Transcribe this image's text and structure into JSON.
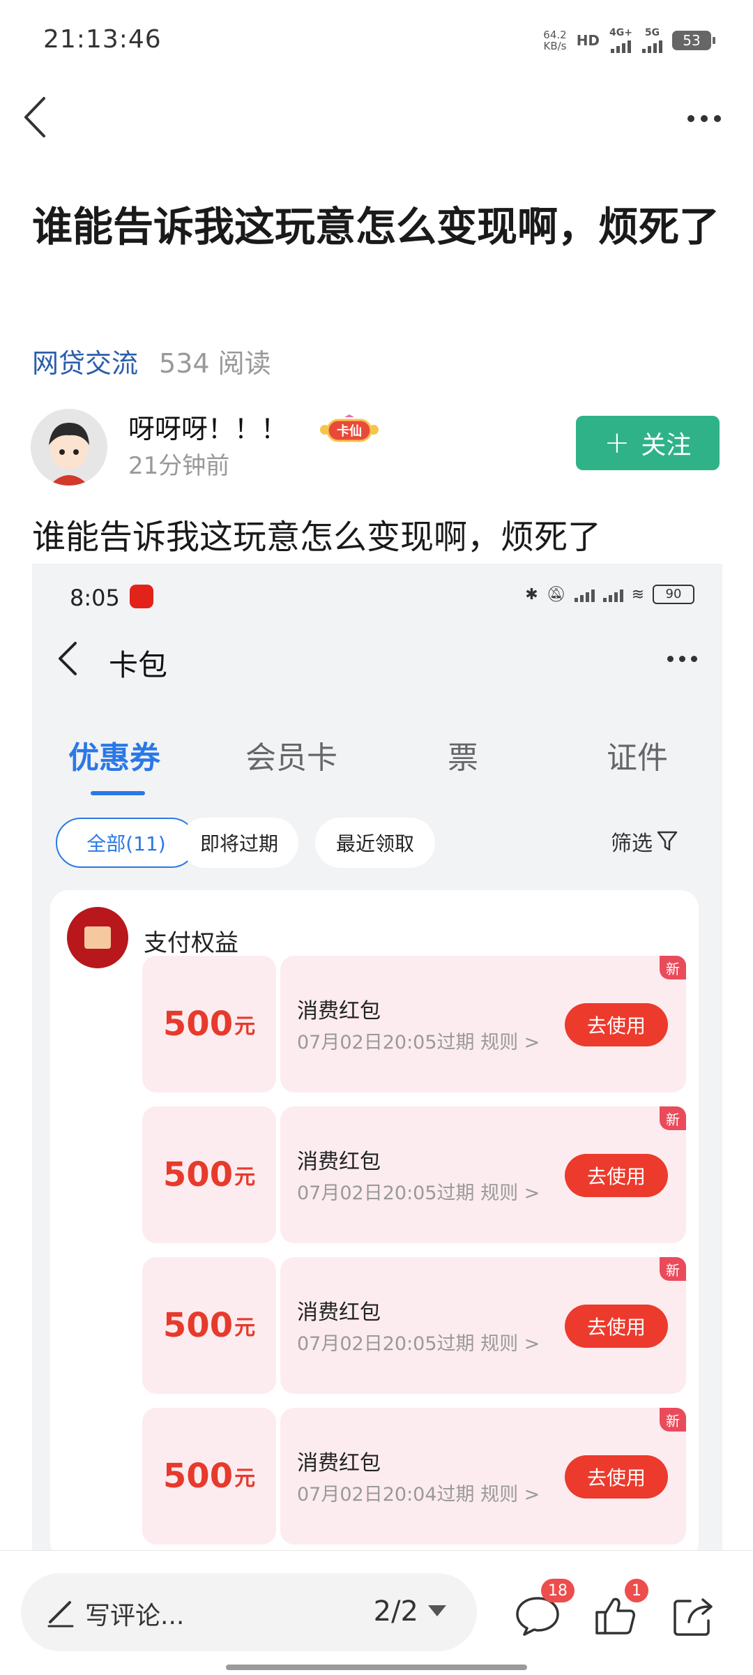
{
  "status_bar": {
    "time": "21:13:46",
    "net_speed_value": "64.2",
    "net_speed_unit": "KB/s",
    "hd_badge": "HD",
    "sim1": "4G+",
    "sim2": "5G",
    "battery": "53"
  },
  "post": {
    "title": "谁能告诉我这玩意怎么变现啊，烦死了",
    "category": "网贷交流",
    "reads": "534 阅读",
    "author": "呀呀呀！！！",
    "badge_text": "卡仙",
    "time": "21分钟前",
    "follow_label": "关注",
    "body": "谁能告诉我这玩意怎么变现啊，烦死了"
  },
  "embedded": {
    "time": "8:05",
    "battery": "90",
    "title": "卡包",
    "tabs": [
      {
        "label": "优惠券",
        "active": true
      },
      {
        "label": "会员卡"
      },
      {
        "label": "票"
      },
      {
        "label": "证件"
      }
    ],
    "chips": [
      {
        "label": "全部(11)",
        "active": true
      },
      {
        "label": "即将过期"
      },
      {
        "label": "最近领取"
      }
    ],
    "filter_label": "筛选",
    "group_title": "支付权益",
    "coupons": [
      {
        "amount": "500",
        "unit": "元",
        "title": "消费红包",
        "expire": "07月02日20:05过期  规则 >",
        "button": "去使用",
        "new": "新"
      },
      {
        "amount": "500",
        "unit": "元",
        "title": "消费红包",
        "expire": "07月02日20:05过期  规则 >",
        "button": "去使用",
        "new": "新"
      },
      {
        "amount": "500",
        "unit": "元",
        "title": "消费红包",
        "expire": "07月02日20:05过期  规则 >",
        "button": "去使用",
        "new": "新"
      },
      {
        "amount": "500",
        "unit": "元",
        "title": "消费红包",
        "expire": "07月02日20:04过期  规则 >",
        "button": "去使用",
        "new": "新"
      }
    ],
    "accent_color": "#2a78e6",
    "coupon_color": "#e63a2c"
  },
  "bottom_bar": {
    "comment_placeholder": "写评论...",
    "pager": "2/2",
    "comment_count": "18",
    "like_count": "1",
    "icons": [
      "comment-icon",
      "like-icon",
      "share-icon"
    ]
  },
  "colors": {
    "follow_green": "#2fb287",
    "category_blue": "#2b5dab",
    "badge_red": "#ee4d4d"
  }
}
